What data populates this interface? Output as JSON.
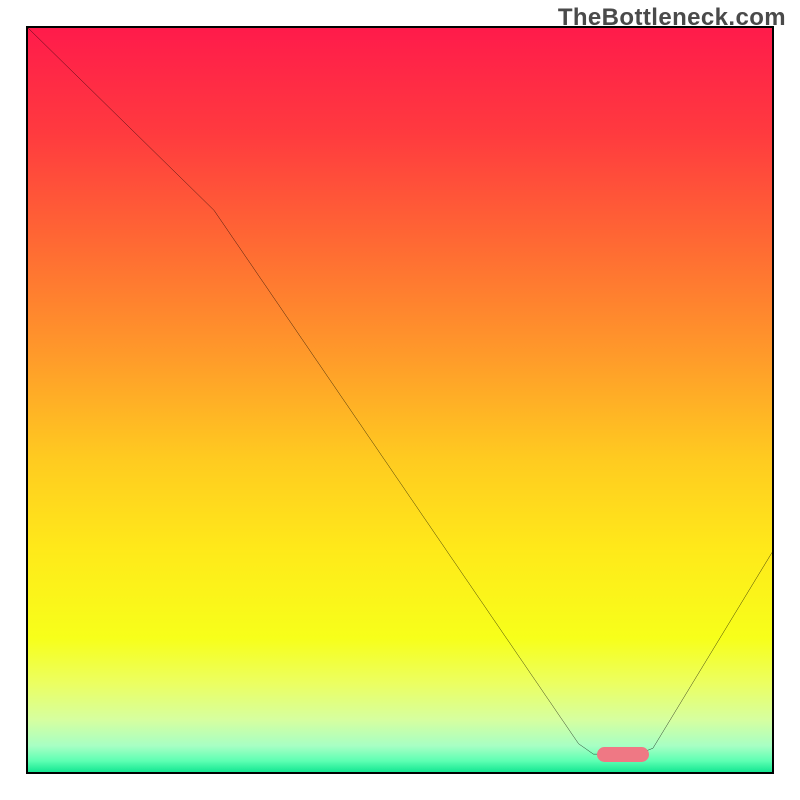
{
  "watermark": "TheBottleneck.com",
  "chart_data": {
    "type": "line",
    "title": "",
    "xlabel": "",
    "ylabel": "",
    "xlim": [
      0,
      100
    ],
    "ylim": [
      0,
      100
    ],
    "grid": false,
    "series": [
      {
        "name": "bottleneck-curve",
        "color": "#000000",
        "x": [
          0,
          25,
          74,
          76,
          82,
          84,
          100
        ],
        "y": [
          100,
          75.5,
          3.8,
          2.4,
          2.4,
          3.2,
          29.5
        ]
      }
    ],
    "marker": {
      "name": "optimal-range",
      "color": "#ef7884",
      "x_start": 76.5,
      "x_end": 83.5,
      "y": 2.4,
      "thickness": 2.0
    },
    "gradient_stops": [
      {
        "pct": 0,
        "color": "#ff1b4b"
      },
      {
        "pct": 14,
        "color": "#ff3a3f"
      },
      {
        "pct": 28,
        "color": "#ff6634"
      },
      {
        "pct": 44,
        "color": "#ff9a2a"
      },
      {
        "pct": 58,
        "color": "#ffcb20"
      },
      {
        "pct": 70,
        "color": "#ffe91a"
      },
      {
        "pct": 82,
        "color": "#f7ff1a"
      },
      {
        "pct": 88,
        "color": "#ecff60"
      },
      {
        "pct": 93,
        "color": "#d6ffa0"
      },
      {
        "pct": 96.5,
        "color": "#a7ffc4"
      },
      {
        "pct": 98.5,
        "color": "#5effb3"
      },
      {
        "pct": 100,
        "color": "#14e792"
      }
    ]
  }
}
